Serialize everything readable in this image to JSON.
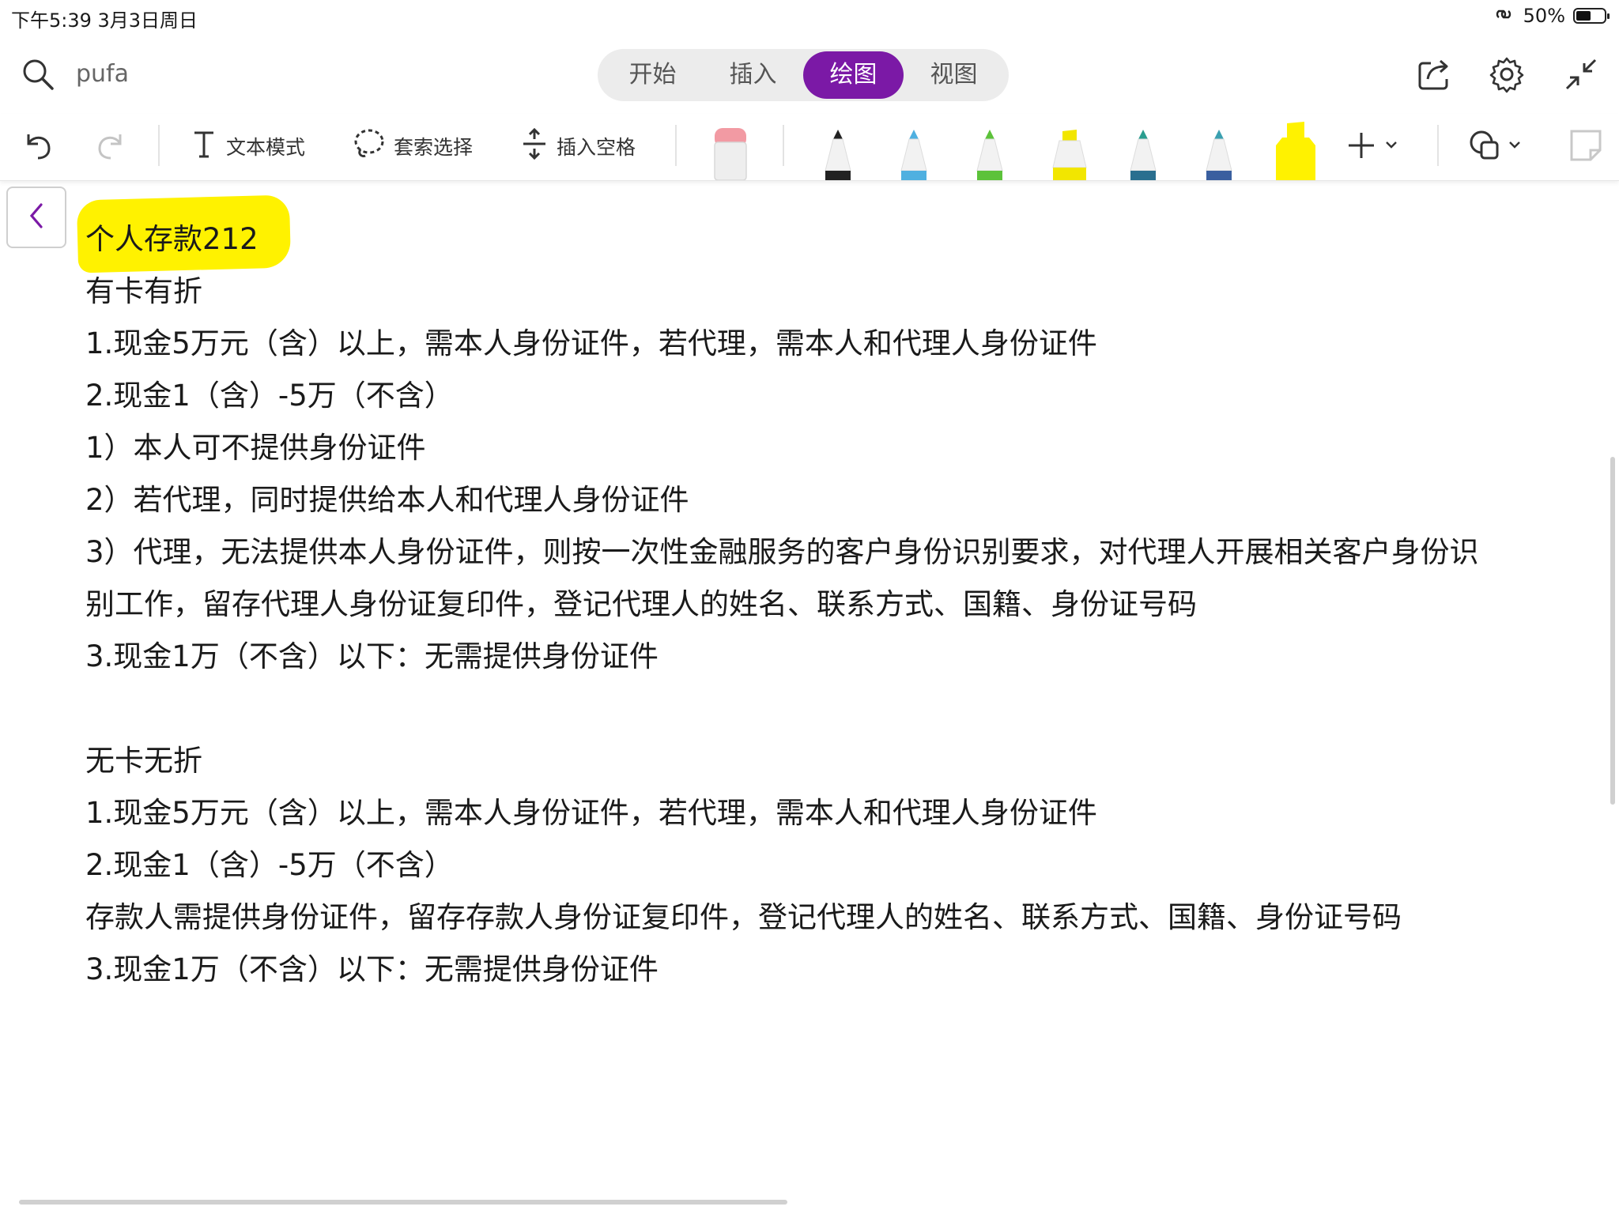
{
  "status_bar": {
    "time": "下午5:39   3月3日周日",
    "battery": "50%",
    "battery_level": 0.5
  },
  "top_bar": {
    "search_text": "pufa",
    "tabs": [
      {
        "label": "开始",
        "active": false
      },
      {
        "label": "插入",
        "active": false
      },
      {
        "label": "绘图",
        "active": true
      },
      {
        "label": "视图",
        "active": false
      }
    ],
    "accent_color": "#7b19a6",
    "icons": [
      "share-icon",
      "settings-icon",
      "collapse-icon"
    ]
  },
  "toolbar": {
    "text_mode": "文本模式",
    "lasso_select": "套索选择",
    "insert_space": "插入空格",
    "pens": [
      {
        "name": "black-pen",
        "color": "#222222"
      },
      {
        "name": "blue-pen",
        "color": "#4fb0e0"
      },
      {
        "name": "green-pen",
        "color": "#5cc23a"
      },
      {
        "name": "yellow-highlighter",
        "color": "#f2e600"
      },
      {
        "name": "galaxy-teal-pen",
        "color": "#2a9d8f"
      },
      {
        "name": "galaxy-blue-pen",
        "color": "#3a7fc0"
      },
      {
        "name": "yellow-highlighter-wide",
        "color": "#fff200"
      }
    ]
  },
  "note": {
    "title": "个人存款212",
    "lines": [
      "有卡有折",
      "1.现金5万元（含）以上，需本人身份证件，若代理，需本人和代理人身份证件",
      "2.现金1（含）-5万（不含）",
      "1）本人可不提供身份证件",
      "2）若代理，同时提供给本人和代理人身份证件",
      "3）代理，无法提供本人身份证件，则按一次性金融服务的客户身份识别要求，对代理人开展相关客户身份识",
      "别工作，留存代理人身份证复印件，登记代理人的姓名、联系方式、国籍、身份证号码",
      "3.现金1万（不含）以下：无需提供身份证件",
      "",
      "无卡无折",
      "1.现金5万元（含）以上，需本人身份证件，若代理，需本人和代理人身份证件",
      "2.现金1（含）-5万（不含）",
      "存款人需提供身份证件，留存存款人身份证复印件，登记代理人的姓名、联系方式、国籍、身份证号码",
      "3.现金1万（不含）以下：无需提供身份证件"
    ]
  }
}
